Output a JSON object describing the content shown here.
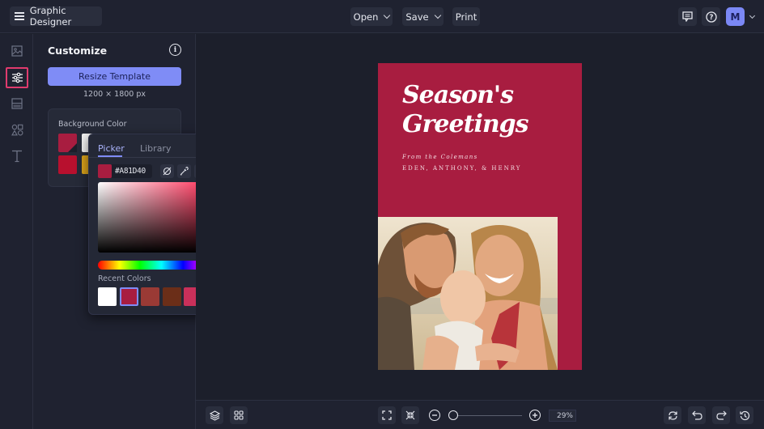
{
  "topbar": {
    "app_title": "Graphic Designer",
    "menu_icon": "hamburger-icon",
    "open_label": "Open",
    "save_label": "Save",
    "print_label": "Print",
    "feedback_icon": "comment-icon",
    "help_icon": "question-circle-icon",
    "avatar_initial": "M",
    "avatar_color": "#7b88f5"
  },
  "rail": {
    "items": [
      {
        "icon": "image-icon",
        "label": "Photos",
        "active": false
      },
      {
        "icon": "sliders-icon",
        "label": "Customize",
        "active": true
      },
      {
        "icon": "layout-icon",
        "label": "Layout",
        "active": false
      },
      {
        "icon": "shapes-icon",
        "label": "Graphics",
        "active": false
      },
      {
        "icon": "text-icon",
        "label": "Text",
        "active": false
      }
    ],
    "active_color": "#e03b6e"
  },
  "panel": {
    "title": "Customize",
    "resize_button": "Resize Template",
    "dimensions": "1200 × 1800 px",
    "background_color_label": "Background Color",
    "swatches": [
      "#a81d40",
      "#f2f2f2",
      "#b8102e",
      "#d9a21b"
    ]
  },
  "picker": {
    "tabs": [
      {
        "label": "Picker",
        "active": true
      },
      {
        "label": "Library",
        "active": false
      }
    ],
    "hex_value": "#A81D40",
    "current_color": "#a81d40",
    "tools": [
      "no-color-icon",
      "eyedropper-icon",
      "grid-icon",
      "plus-icon"
    ],
    "recent_label": "Recent Colors",
    "recent_colors": [
      "#ffffff",
      "#a81d40",
      "#9a3a35",
      "#6b2e18",
      "#c9305a",
      "#8f2040"
    ],
    "selected_recent_index": 1
  },
  "card": {
    "title_line1": "Season's",
    "title_line2": "Greetings",
    "from_line": "From the Colemans",
    "names_line": "EDEN, ANTHONY, & HENRY",
    "background": "#a81d40",
    "photo_alt": "Family photo: father, mother and baby embracing on a beach"
  },
  "bottombar": {
    "layers_icon": "layers-icon",
    "grid_icon": "grid-view-icon",
    "fit_icon": "fit-screen-icon",
    "shrink_icon": "shrink-icon",
    "zoom_out_icon": "zoom-out-icon",
    "zoom_in_icon": "zoom-in-icon",
    "zoom_level": "29%",
    "zoom_fraction": 0.29,
    "reset_icon": "refresh-icon",
    "undo_icon": "undo-icon",
    "redo_icon": "redo-icon",
    "history_icon": "history-icon"
  }
}
